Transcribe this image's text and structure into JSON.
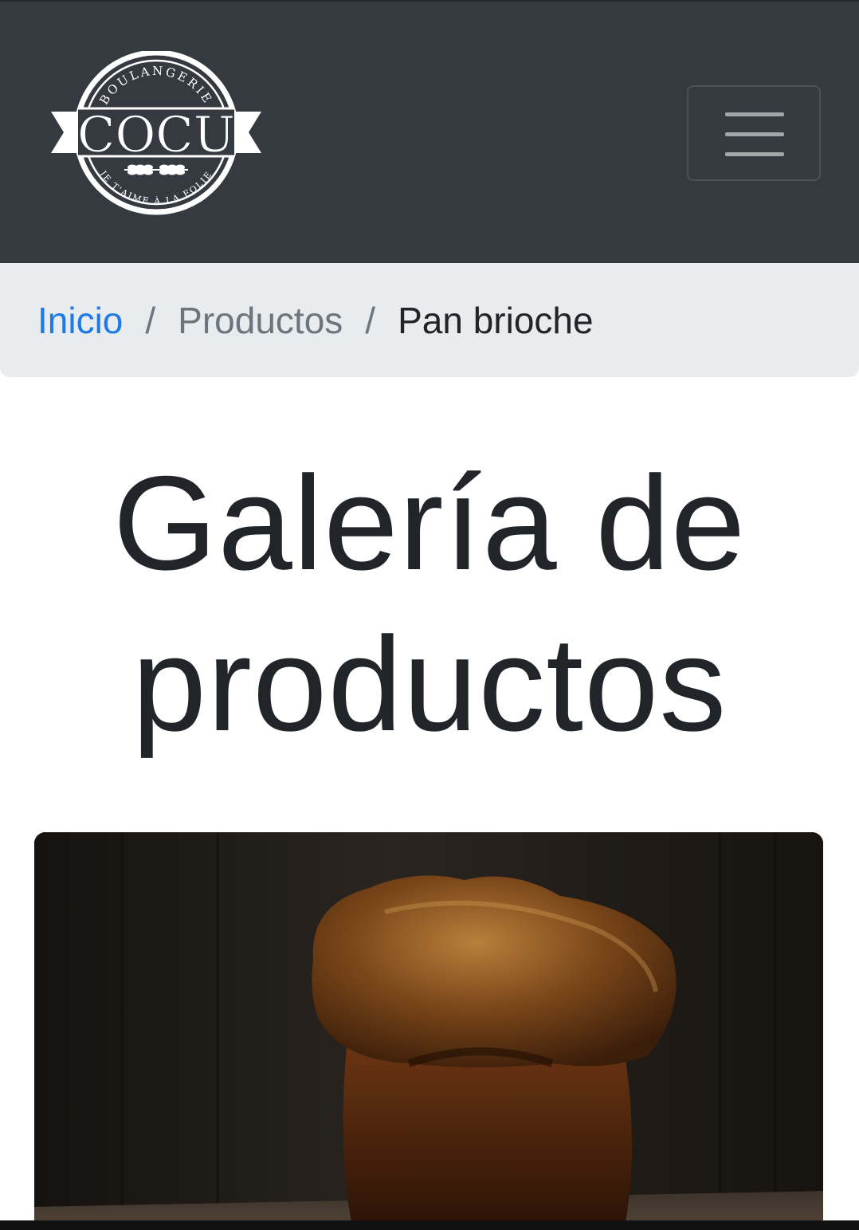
{
  "navbar": {
    "logo": {
      "top_text": "BOULANGERIE",
      "brand": "COCU",
      "bottom_text": "JE T'AIME À LA FOLIE"
    },
    "menu_icon": "hamburger-menu-icon",
    "background_color": "#343a40"
  },
  "breadcrumb": {
    "items": [
      {
        "label": "Inicio",
        "state": "link"
      },
      {
        "label": "Productos",
        "state": "link"
      },
      {
        "label": "Pan brioche",
        "state": "active"
      }
    ],
    "separator": "/"
  },
  "main": {
    "title": "Galería de productos"
  },
  "gallery": {
    "image_subject": "pan-brioche-photo"
  },
  "colors": {
    "link": "#1e7be6",
    "muted": "#6c757d",
    "text": "#212529",
    "breadcrumb_bg": "#e9ecef"
  }
}
